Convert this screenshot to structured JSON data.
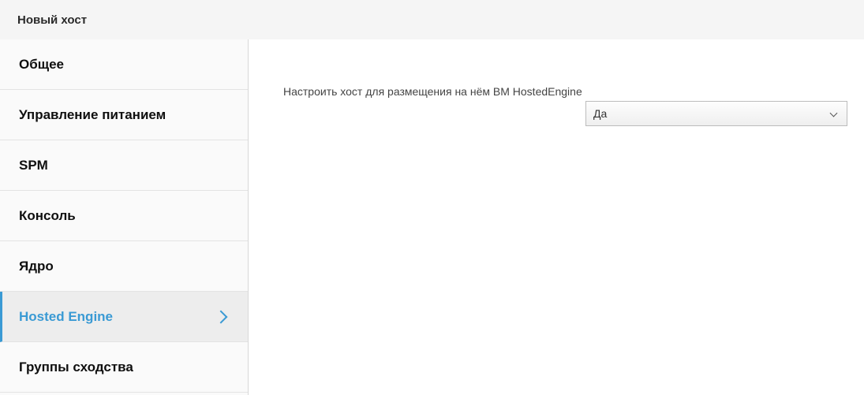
{
  "dialog": {
    "title": "Новый хост"
  },
  "sidebar": {
    "items": [
      {
        "label": "Общее",
        "active": false
      },
      {
        "label": "Управление питанием",
        "active": false
      },
      {
        "label": "SPM",
        "active": false
      },
      {
        "label": "Консоль",
        "active": false
      },
      {
        "label": "Ядро",
        "active": false
      },
      {
        "label": "Hosted Engine",
        "active": true
      },
      {
        "label": "Группы сходства",
        "active": false
      }
    ]
  },
  "hosted_engine": {
    "field_label": "Настроить хост для размещения на нём ВМ HostedEngine",
    "select_value": "Да"
  },
  "colors": {
    "accent": "#3a9ad4",
    "header_bg": "#f5f5f5",
    "sidebar_bg": "#fafafa"
  }
}
